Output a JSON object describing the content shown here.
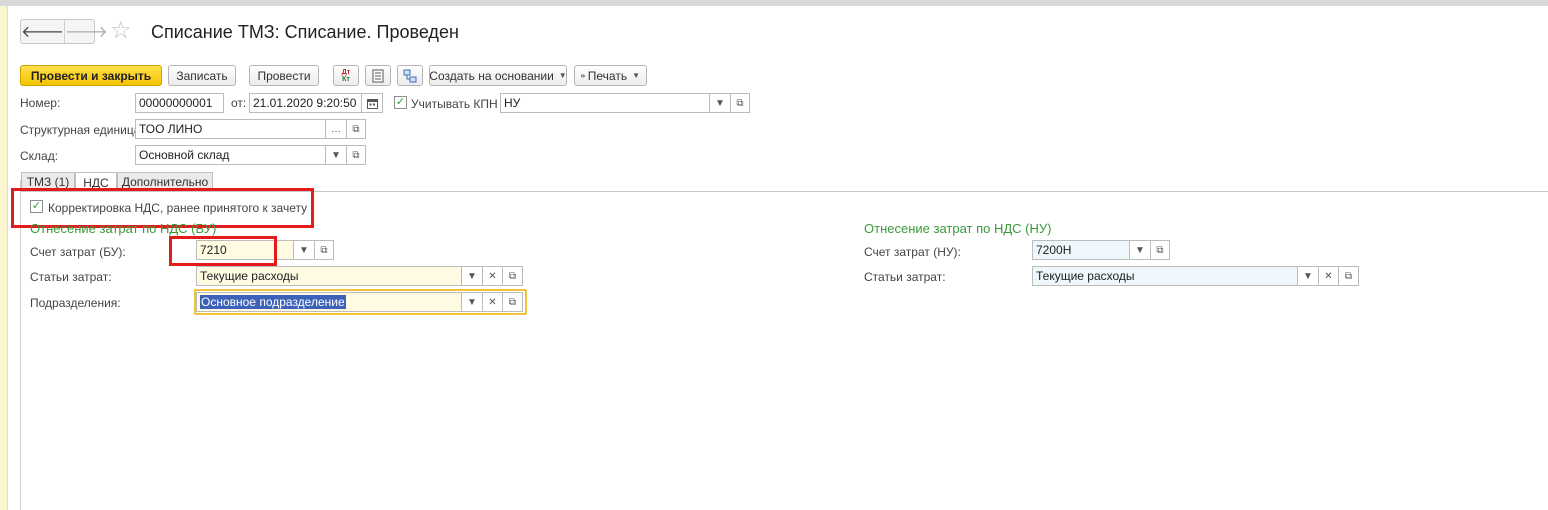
{
  "window": {
    "title": "Списание ТМЗ: Списание. Проведен"
  },
  "nav": {
    "back_glyph": "🡐",
    "forward_glyph": "🡒",
    "star_glyph": "☆"
  },
  "toolbar": {
    "post_close": "Провести и закрыть",
    "save": "Записать",
    "post": "Провести",
    "dtkt_icon": "Дт Кт",
    "create_based": "Создать на основании",
    "print": "Печать"
  },
  "header": {
    "number_label": "Номер:",
    "number_value": "00000000001",
    "date_label": "от:",
    "date_value": "21.01.2020  9:20:50",
    "kpn_label": "Учитывать КПН",
    "kpn_checked": true,
    "kpn_value": "НУ",
    "unit_label": "Структурная единица:",
    "unit_value": "ТОО ЛИНО",
    "warehouse_label": "Склад:",
    "warehouse_value": "Основной склад"
  },
  "tabs": [
    {
      "label": "ТМЗ (1)",
      "active": false
    },
    {
      "label": "НДС",
      "active": true
    },
    {
      "label": "Дополнительно",
      "active": false
    }
  ],
  "vat": {
    "correction_label": "Корректировка НДС, ранее принятого к зачету",
    "correction_checked": true,
    "bu": {
      "section_title": "Отнесение затрат по НДС (БУ)",
      "account_label": "Счет затрат (БУ):",
      "account_value": "7210",
      "items_label": "Статьи затрат:",
      "items_value": "Текущие расходы",
      "dept_label": "Подразделения:",
      "dept_value": "Основное подразделение"
    },
    "nu": {
      "section_title": "Отнесение затрат по НДС (НУ)",
      "account_label": "Счет затрат (НУ):",
      "account_value": "7200Н",
      "items_label": "Статьи затрат:",
      "items_value": "Текущие расходы"
    }
  },
  "colors": {
    "accent_green": "#3a9a3a",
    "primary_button": "#f5c400",
    "highlight_red": "#e41b1b"
  }
}
